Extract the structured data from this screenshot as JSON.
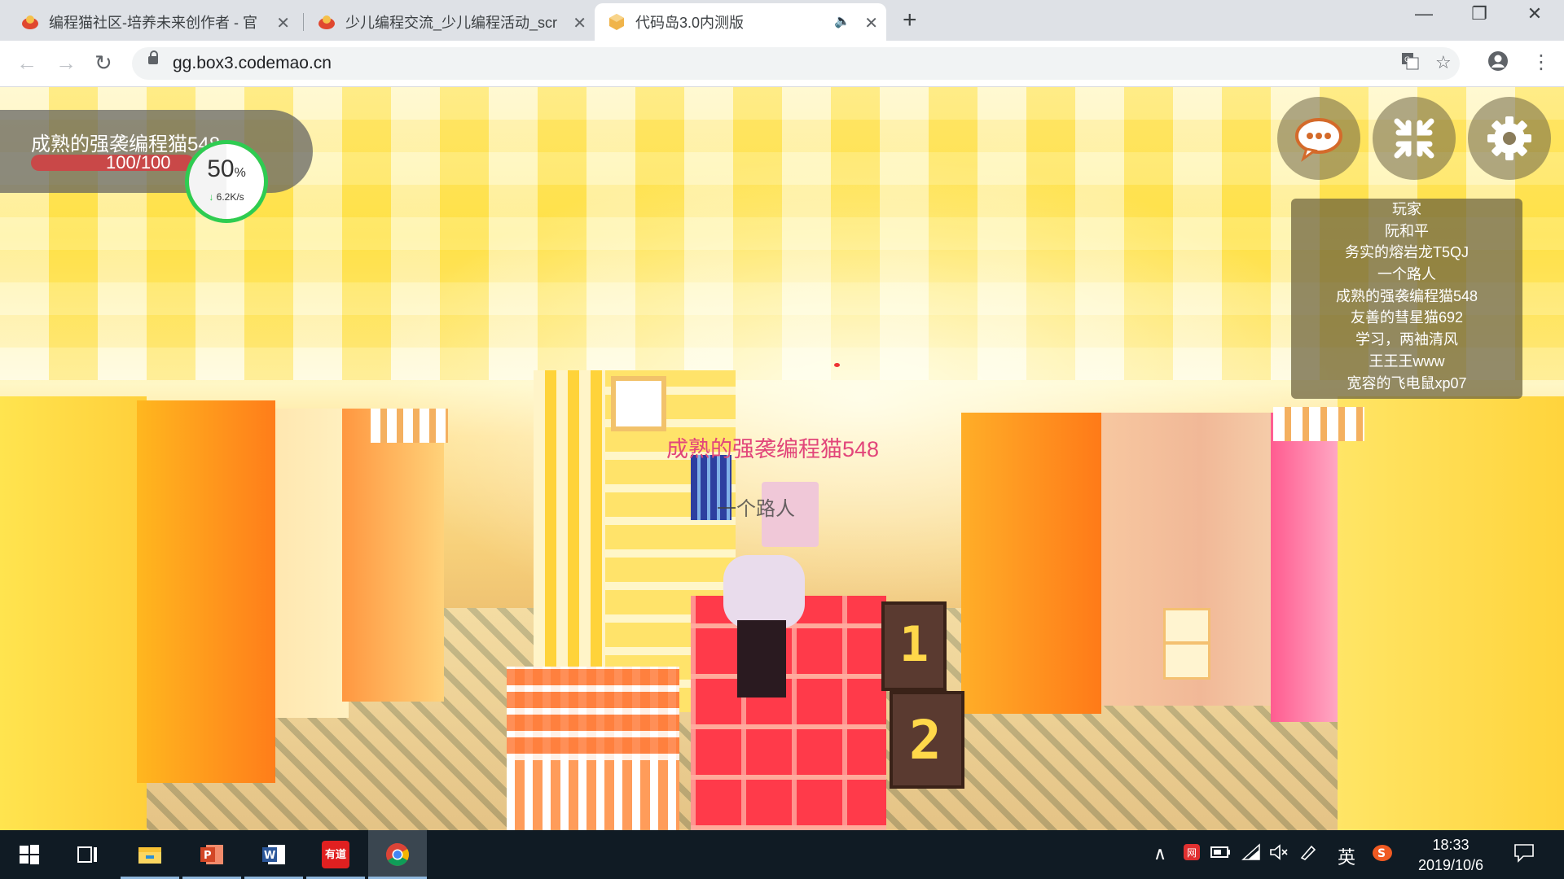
{
  "browser": {
    "tabs": [
      {
        "title": "编程猫社区-培养未来创作者 - 官",
        "icon": "codemao-favicon"
      },
      {
        "title": "少儿编程交流_少儿编程活动_scr",
        "icon": "codemao-favicon"
      },
      {
        "title": "代码岛3.0内测版",
        "icon": "box3-favicon",
        "audio": true
      }
    ],
    "active_tab": 2,
    "url": "gg.box3.codemao.cn"
  },
  "game": {
    "player_name": "成熟的强袭编程猫548",
    "hp": "100/100",
    "hp_fraction": 1.0,
    "net": {
      "percent": "50",
      "percent_unit": "%",
      "speed": "6.2K/s",
      "fill_fraction": 0.5
    },
    "buttons": [
      {
        "name": "chat-button",
        "icon": "chat-bubble-icon"
      },
      {
        "name": "shrink-button",
        "icon": "collapse-arrows-icon"
      },
      {
        "name": "settings-button",
        "icon": "gear-icon"
      }
    ],
    "players_header": "玩家",
    "players": [
      "阮和平",
      "务实的熔岩龙T5QJ",
      "一个路人",
      "成熟的强袭编程猫548",
      "友善的彗星猫692",
      "学习，两袖清风",
      "王王王www",
      "宽容的飞电鼠xp07"
    ],
    "nametag_self": "成熟的强袭编程猫548",
    "nametag_other": "一个路人",
    "block_labels": [
      "1",
      "2"
    ]
  },
  "taskbar": {
    "apps": [
      "windows-start-icon",
      "task-view-icon",
      "file-explorer-icon",
      "powerpoint-icon",
      "word-icon",
      "youdao-icon",
      "chrome-icon"
    ],
    "youdao_label": "有道",
    "ime": "英",
    "time": "18:33",
    "date": "2019/10/6"
  },
  "colors": {
    "accent_green": "#2ecc51",
    "hp_red": "#c94848",
    "nametag_pink": "#e2467a"
  }
}
